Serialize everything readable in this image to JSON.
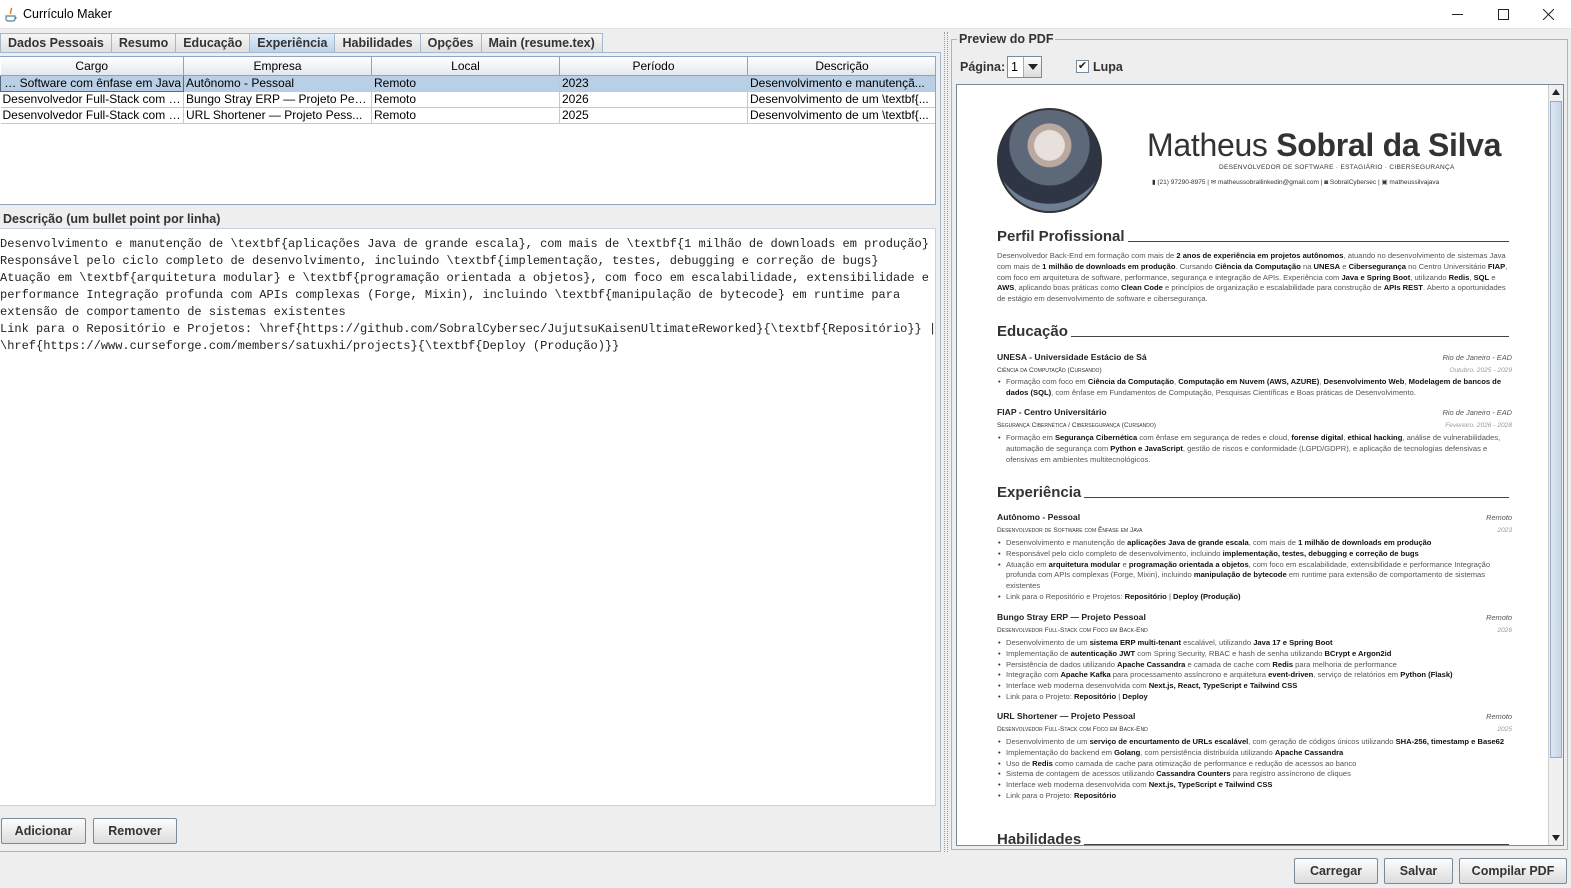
{
  "window": {
    "title": "Currículo Maker"
  },
  "tabs": [
    {
      "label": "Dados Pessoais"
    },
    {
      "label": "Resumo"
    },
    {
      "label": "Educação"
    },
    {
      "label": "Experiência",
      "active": true
    },
    {
      "label": "Habilidades"
    },
    {
      "label": "Opções"
    },
    {
      "label": "Main (resume.tex)"
    }
  ],
  "table": {
    "headers": [
      "Cargo",
      "Empresa",
      "Local",
      "Período",
      "Descrição"
    ],
    "rows": [
      [
        "de Software com ênfase em Java",
        "Autônomo - Pessoal",
        "Remoto",
        "2023",
        "Desenvolvimento e manutençã..."
      ],
      [
        "Desenvolvedor Full-Stack com F...",
        "Bungo Stray ERP — Projeto Pes...",
        "Remoto",
        "2026",
        "Desenvolvimento de um \\textbf{..."
      ],
      [
        "Desenvolvedor Full-Stack com F...",
        "URL Shortener — Projeto Pess...",
        "Remoto",
        "2025",
        "Desenvolvimento de um \\textbf{..."
      ]
    ]
  },
  "description": {
    "label": "Descrição (um bullet point por linha)",
    "lines": [
      "Desenvolvimento e manutenção de \\textbf{aplicações Java de grande escala}, com mais de \\textbf{1 milhão de downloads em produção}",
      "Responsável pelo ciclo completo de desenvolvimento, incluindo \\textbf{implementação, testes, debugging e correção de bugs}",
      "Atuação em \\textbf{arquitetura modular} e \\textbf{programação orientada a objetos}, com foco em escalabilidade, extensibilidade e",
      "performance Integração profunda com APIs complexas (Forge, Mixin), incluindo \\textbf{manipulação de bytecode} em runtime para",
      "extensão de comportamento de sistemas existentes",
      "Link para o Repositório e Projetos: \\href{https://github.com/SobralCybersec/JujutsuKaisenUltimateReworked}{\\textbf{Repositório}} |",
      "\\href{https://www.curseforge.com/members/satuxhi/projects}{\\textbf{Deploy (Produção)}}"
    ]
  },
  "buttons": {
    "add": "Adicionar",
    "remove": "Remover",
    "load": "Carregar",
    "save": "Salvar",
    "compile": "Compilar PDF"
  },
  "preview": {
    "title": "Preview do PDF",
    "page_label": "Página:",
    "page_value": "1",
    "lupa_label": "Lupa",
    "lupa_checked": true
  },
  "pdf": {
    "name_first": "Matheus",
    "name_last": "Sobral da Silva",
    "subtitle": "Desenvolvedor de Software · Estagiário · Cibersegurança",
    "contacts": "▮ (21) 97290-8975  |  ✉ matheussobrallinkedin@gmail.com  |  ◙ SobralCybersec  |  ▣ matheussilvajava",
    "sections": {
      "profile": "Perfil Profissional",
      "education": "Educação",
      "experience": "Experiência",
      "skills": "Habilidades"
    },
    "education": [
      {
        "school": "UNESA - Universidade Estácio de Sá",
        "location": "Rio de Janeiro - EAD",
        "course": "Ciência da Computação (Cursando)",
        "dates": "Outubro. 2025 - 2029"
      },
      {
        "school": "FIAP - Centro Universitário",
        "location": "Rio de Janeiro - EAD",
        "course": "Segurança Cibernética / Cibersegurança (Cursando)",
        "dates": "Fevereiro. 2026 - 2028"
      }
    ],
    "experience": [
      {
        "company": "Autônomo - Pessoal",
        "location": "Remoto",
        "role": "Desenvolvedor de Software com Ênfase em Java",
        "dates": "2023"
      },
      {
        "company": "Bungo Stray ERP — Projeto Pessoal",
        "location": "Remoto",
        "role": "Desenvolvedor Full-Stack com Foco em Back-End",
        "dates": "2026"
      },
      {
        "company": "URL Shortener — Projeto Pessoal",
        "location": "Remoto",
        "role": "Desenvolvedor Full-Stack com Foco em Back-End",
        "dates": "2025"
      }
    ]
  },
  "colors": {
    "selection": "#b8cfe5",
    "tab_border": "#a3b8cc",
    "background": "#eeeeee"
  }
}
